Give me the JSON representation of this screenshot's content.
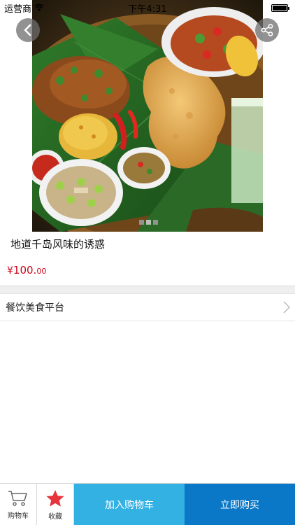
{
  "status_bar": {
    "carrier": "运营商",
    "time": "下午4:31"
  },
  "product": {
    "title": "地道千岛风味的诱惑",
    "price_symbol": "¥",
    "price_integer": "100.",
    "price_decimal": "00",
    "image_pages": 3,
    "active_page": 2
  },
  "shop": {
    "name": "餐饮美食平台"
  },
  "bottom_bar": {
    "cart_label": "购物车",
    "favorite_label": "收藏",
    "add_to_cart_label": "加入购物车",
    "buy_now_label": "立即购买"
  },
  "colors": {
    "price": "#d0021b",
    "add_to_cart_bg": "#33b1e3",
    "buy_now_bg": "#0a77c7",
    "favorite_star": "#e8323c"
  }
}
